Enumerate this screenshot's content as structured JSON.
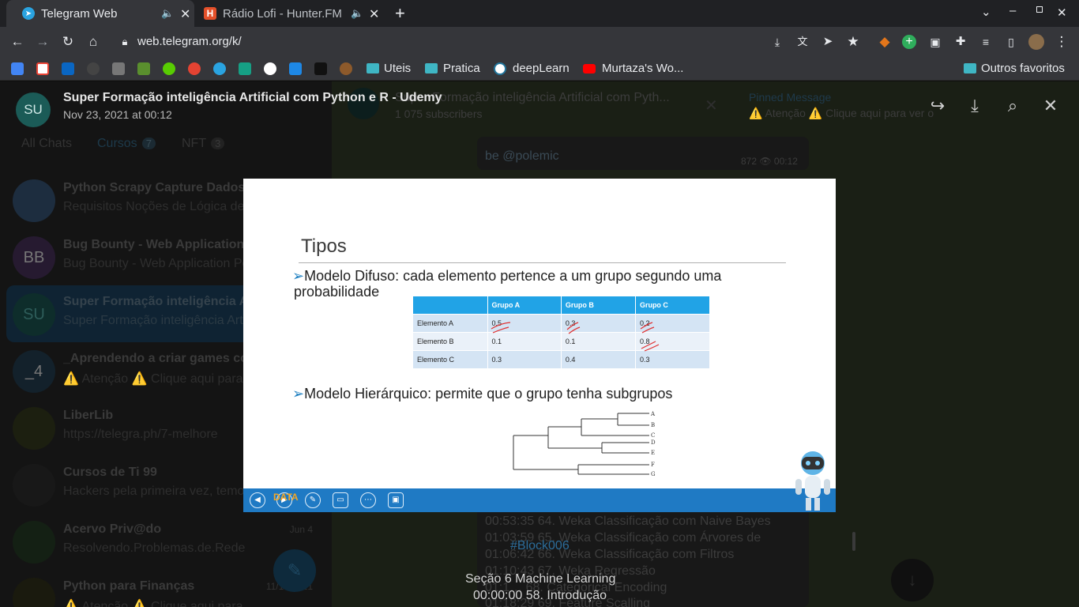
{
  "browser": {
    "tabs": [
      {
        "title": "Telegram Web",
        "favicon": "telegram-icon",
        "active": true
      },
      {
        "title": "Rádio Lofi - Hunter.FM",
        "favicon": "hunter-fm-icon",
        "active": false
      }
    ],
    "new_tab": "+",
    "url": "web.telegram.org/k/",
    "bookmarks": [
      {
        "label": "Uteis",
        "icon": "folder-icon"
      },
      {
        "label": "Pratica",
        "icon": "folder-icon"
      },
      {
        "label": "deepLearn",
        "icon": "wordpress-icon"
      },
      {
        "label": "Murtaza's Wo...",
        "icon": "youtube-icon"
      }
    ],
    "other_bookmarks": "Outros favoritos"
  },
  "sidebar": {
    "folders": [
      {
        "label": "All Chats",
        "count": ""
      },
      {
        "label": "Cursos",
        "count": "7"
      },
      {
        "label": "NFT",
        "count": "3"
      }
    ],
    "chats": [
      {
        "name": "Python Scrapy Capture Dados W",
        "preview": "Requisitos Noções de Lógica de",
        "avatar": "",
        "date": ""
      },
      {
        "name": "Bug Bounty - Web Application Pe",
        "preview": "Bug Bounty - Web Application Pe",
        "avatar": "BB",
        "date": ""
      },
      {
        "name": "Super Formação inteligência Art",
        "preview": "Super Formação inteligência Art",
        "avatar": "SU",
        "date": ""
      },
      {
        "name": "_Aprendendo a criar games com",
        "preview": "⚠️ Atenção ⚠️ Clique aqui para",
        "avatar": "_4",
        "date": ""
      },
      {
        "name": "LiberLib",
        "preview": "https://telegra.ph/7-melhore",
        "avatar": "",
        "date": ""
      },
      {
        "name": "Cursos de Ti 99",
        "preview": "Hackers pela primeira vez, temo",
        "avatar": "",
        "date": ""
      },
      {
        "name": "Acervo Priv@do",
        "preview": "Resolvendo.Problemas.de.Rede.com.",
        "avatar": "",
        "date": "Jun 4"
      },
      {
        "name": "Python para Finanças",
        "preview": "⚠️ Atenção ⚠️ Clique aqui para ver o",
        "avatar": "",
        "date": "11/15/2021"
      }
    ]
  },
  "viewer": {
    "avatar": "SU",
    "title": "Super Formação inteligência Artificial com Python e R - Udemy",
    "date": "Nov 23, 2021 at 00:12"
  },
  "background_chat": {
    "title": "Super Formação inteligência Artificial com Pyth...",
    "subscribers": "1 075 subscribers",
    "pinned_label": "Pinned Message",
    "pinned_text": "⚠️ Atenção ⚠️ Clique aqui para ver o",
    "msg_text": "be @polemic",
    "msg_meta": "872 👁 00:12",
    "lines": [
      "00:53:35 64. Weka Classificação com Naive Bayes",
      "01:03:59 65. Weka Classificação com Árvores de",
      "01:06:42 66. Weka Classificação com Filtros",
      "01:10:43 67. Weka Regressão",
      "01:1… 68. Categorical Encoding",
      "01:18:29 69. Feature Scalling"
    ]
  },
  "caption": {
    "hashtag": "#Block006",
    "line1": "Seção 6 Machine Learning",
    "line2": "00:00:00 58. Introdução"
  },
  "slide": {
    "title": "Tipos",
    "bullet1": "Modelo Difuso: cada elemento pertence a um grupo segundo uma",
    "bullet1_cont": "probabilidade",
    "bullet2": "Modelo Hierárquico: permite que o grupo tenha subgrupos",
    "table": {
      "headers": [
        "",
        "Grupo A",
        "Grupo B",
        "Grupo C"
      ],
      "rows": [
        [
          "Elemento A",
          "0.5",
          "0.3",
          "0.2"
        ],
        [
          "Elemento B",
          "0.1",
          "0.1",
          "0.8"
        ],
        [
          "Elemento C",
          "0.3",
          "0.4",
          "0.3"
        ]
      ]
    },
    "dendrogram_leaves": [
      "A",
      "B",
      "C",
      "D",
      "E",
      "F",
      "G"
    ],
    "logo_text": "DATA"
  },
  "colors": {
    "accent": "#21a3e6",
    "slide_bar": "#1f7ac4",
    "avatar_teal": "#1b5b57"
  }
}
